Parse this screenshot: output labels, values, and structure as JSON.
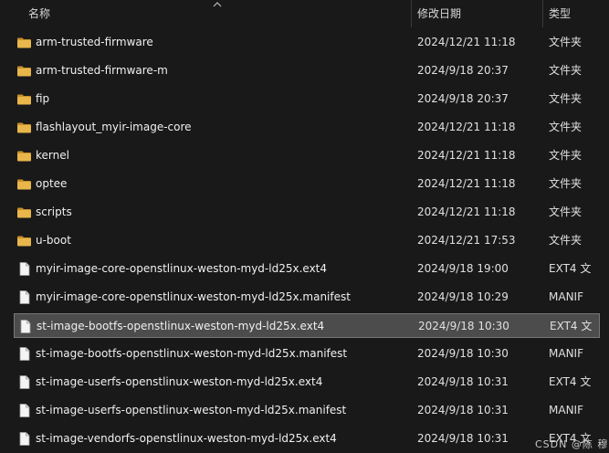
{
  "header": {
    "name_label": "名称",
    "date_label": "修改日期",
    "type_label": "类型"
  },
  "rows": [
    {
      "name": "arm-trusted-firmware",
      "date": "2024/12/21 11:18",
      "type": "文件夹",
      "icon": "folder-icon"
    },
    {
      "name": "arm-trusted-firmware-m",
      "date": "2024/9/18 20:37",
      "type": "文件夹",
      "icon": "folder-icon"
    },
    {
      "name": "fip",
      "date": "2024/9/18 20:37",
      "type": "文件夹",
      "icon": "folder-icon"
    },
    {
      "name": "flashlayout_myir-image-core",
      "date": "2024/12/21 11:18",
      "type": "文件夹",
      "icon": "folder-icon"
    },
    {
      "name": "kernel",
      "date": "2024/12/21 11:18",
      "type": "文件夹",
      "icon": "folder-icon"
    },
    {
      "name": "optee",
      "date": "2024/12/21 11:18",
      "type": "文件夹",
      "icon": "folder-icon"
    },
    {
      "name": "scripts",
      "date": "2024/12/21 11:18",
      "type": "文件夹",
      "icon": "folder-icon"
    },
    {
      "name": "u-boot",
      "date": "2024/12/21 17:53",
      "type": "文件夹",
      "icon": "folder-icon"
    },
    {
      "name": "myir-image-core-openstlinux-weston-myd-ld25x.ext4",
      "date": "2024/9/18 19:00",
      "type": "EXT4 文",
      "icon": "file-icon"
    },
    {
      "name": "myir-image-core-openstlinux-weston-myd-ld25x.manifest",
      "date": "2024/9/18 10:29",
      "type": "MANIF",
      "icon": "file-icon"
    },
    {
      "name": "st-image-bootfs-openstlinux-weston-myd-ld25x.ext4",
      "date": "2024/9/18 10:30",
      "type": "EXT4 文",
      "icon": "file-icon",
      "selected": true
    },
    {
      "name": "st-image-bootfs-openstlinux-weston-myd-ld25x.manifest",
      "date": "2024/9/18 10:30",
      "type": "MANIF",
      "icon": "file-icon"
    },
    {
      "name": "st-image-userfs-openstlinux-weston-myd-ld25x.ext4",
      "date": "2024/9/18 10:31",
      "type": "EXT4 文",
      "icon": "file-icon"
    },
    {
      "name": "st-image-userfs-openstlinux-weston-myd-ld25x.manifest",
      "date": "2024/9/18 10:31",
      "type": "MANIF",
      "icon": "file-icon"
    },
    {
      "name": "st-image-vendorfs-openstlinux-weston-myd-ld25x.ext4",
      "date": "2024/9/18 10:31",
      "type": "EXT4 文",
      "icon": "file-icon"
    }
  ],
  "watermark": "CSDN @陈 穆",
  "colors": {
    "folder": "#e8b64a",
    "selection": "#4c4c4c"
  }
}
